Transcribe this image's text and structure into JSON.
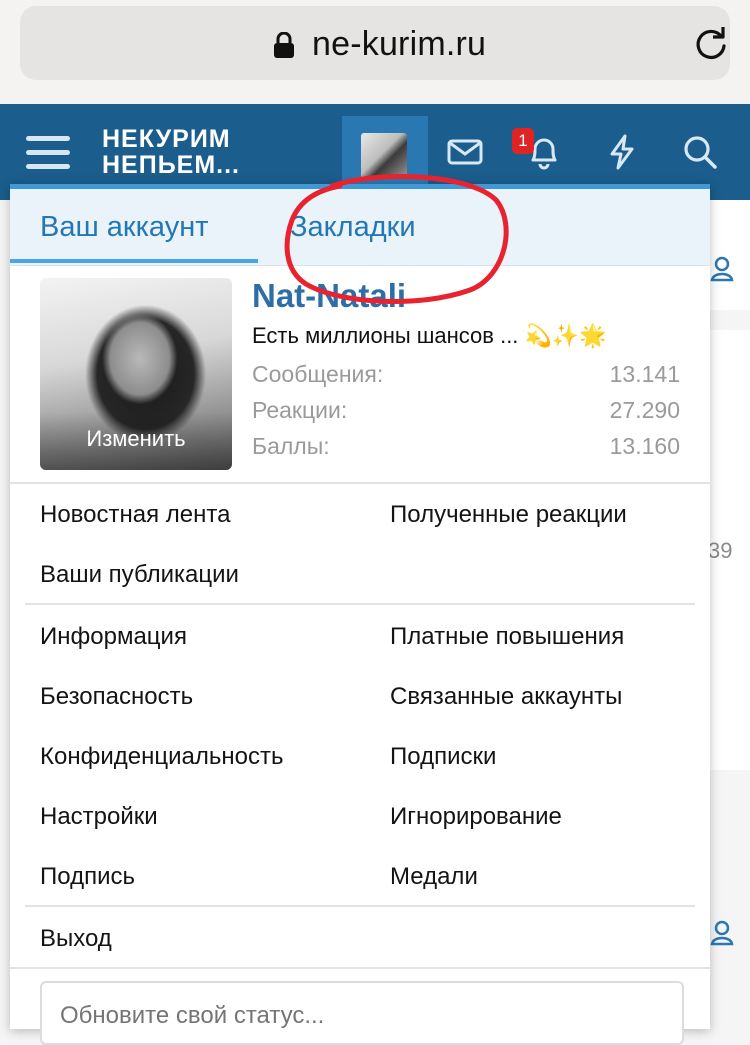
{
  "browser": {
    "url": "ne-kurim.ru"
  },
  "header": {
    "logo_line1": "НЕКУРИМ",
    "logo_line2": "НЕПЬЕМ...",
    "notifications_count": "1",
    "icons": [
      "hamburger-icon",
      "avatar",
      "envelope-icon",
      "bell-icon",
      "lightning-icon",
      "search-icon"
    ],
    "color": "#1b5d8c"
  },
  "background": {
    "number_fragment": "39"
  },
  "account_popup": {
    "tabs": [
      "Ваш аккаунт",
      "Закладки"
    ],
    "active_tab": "Ваш аккаунт",
    "photo_action": "Изменить",
    "username": "Nat-Natali",
    "status_text": "Есть миллионы шансов ... 💫✨🌟",
    "stats": [
      {
        "label": "Сообщения:",
        "value": "13.141"
      },
      {
        "label": "Реакции:",
        "value": "27.290"
      },
      {
        "label": "Баллы:",
        "value": "13.160"
      }
    ],
    "section1": {
      "left": [
        "Новостная лента",
        "Ваши публикации"
      ],
      "right": [
        "Полученные реакции"
      ]
    },
    "section2": {
      "left": [
        "Информация",
        "Безопасность",
        "Конфиденциальность",
        "Настройки",
        "Подпись"
      ],
      "right": [
        "Платные повышения",
        "Связанные аккаунты",
        "Подписки",
        "Игнорирование",
        "Медали"
      ]
    },
    "logout": "Выход",
    "status_input_placeholder": "Обновите свой статус..."
  },
  "annotation": {
    "color": "#e8232f"
  }
}
